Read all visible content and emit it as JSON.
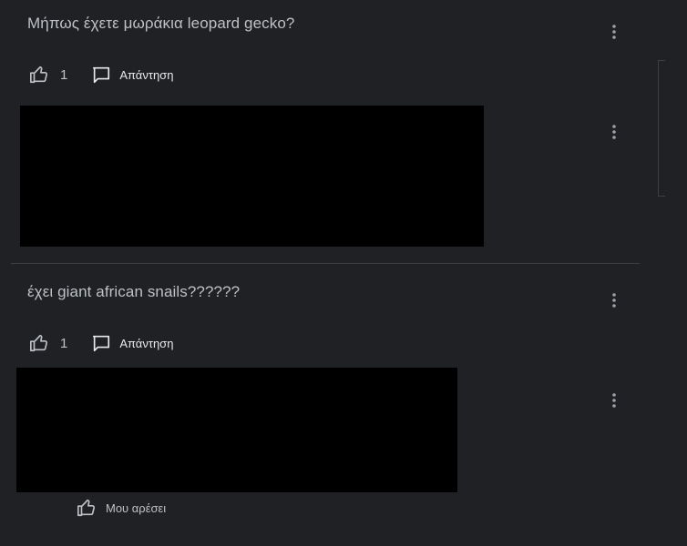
{
  "threads": [
    {
      "question": "Μήπως έχετε μωράκια leopard gecko?",
      "like_count": "1",
      "reply_label": "Απάντηση"
    },
    {
      "question": "έχει giant african snails??????",
      "like_count": "1",
      "reply_label": "Απάντηση"
    }
  ],
  "answer_like_label": "Μου αρέσει",
  "icons": {
    "like": "thumb-up-icon",
    "reply": "comment-icon",
    "more": "more-vert-icon"
  },
  "colors": {
    "background": "#202124",
    "text": "#bdc1c6",
    "icon": "#9aa0a6",
    "redaction": "#000000"
  }
}
